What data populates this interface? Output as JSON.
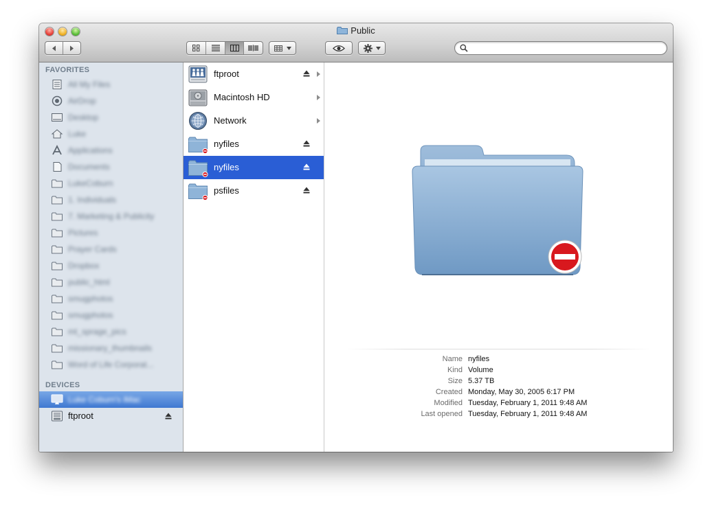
{
  "window": {
    "title": "Public",
    "title_icon": "folder-icon"
  },
  "toolbar": {
    "back_icon": "chevron-left-icon",
    "forward_icon": "chevron-right-icon",
    "view_modes": [
      "icon-view",
      "list-view",
      "column-view",
      "coverflow-view"
    ],
    "active_view": "column-view",
    "arrange_icon": "arrange-grid-icon",
    "quicklook_icon": "eye-icon",
    "action_icon": "gear-icon",
    "search_placeholder": "",
    "search_value": ""
  },
  "sidebar": {
    "favorites_heading": "FAVORITES",
    "favorites": [
      {
        "label": "All My Files",
        "icon": "all-files-icon"
      },
      {
        "label": "AirDrop",
        "icon": "airdrop-icon"
      },
      {
        "label": "Desktop",
        "icon": "desktop-icon"
      },
      {
        "label": "Luke",
        "icon": "home-icon"
      },
      {
        "label": "Applications",
        "icon": "applications-icon"
      },
      {
        "label": "Documents",
        "icon": "documents-icon"
      },
      {
        "label": "LukeCoburn",
        "icon": "folder-icon"
      },
      {
        "label": "1. Individuals",
        "icon": "folder-icon"
      },
      {
        "label": "7. Marketing & Publicity",
        "icon": "folder-icon"
      },
      {
        "label": "Pictures",
        "icon": "folder-icon"
      },
      {
        "label": "Prayer Cards",
        "icon": "folder-icon"
      },
      {
        "label": "Dropbox",
        "icon": "folder-icon"
      },
      {
        "label": "public_html",
        "icon": "folder-icon"
      },
      {
        "label": "smugphotos",
        "icon": "folder-icon"
      },
      {
        "label": "smugphotos",
        "icon": "folder-icon"
      },
      {
        "label": "mt_sprage_pics",
        "icon": "folder-icon"
      },
      {
        "label": "missionary_thumbnails",
        "icon": "folder-icon"
      },
      {
        "label": "Word of Life Corporat...",
        "icon": "folder-icon"
      }
    ],
    "devices_heading": "DEVICES",
    "devices": [
      {
        "label": "Luke Coburn's iMac",
        "icon": "imac-icon",
        "selected": true
      },
      {
        "label": "ftproot",
        "icon": "server-icon",
        "eject": true
      }
    ]
  },
  "column": {
    "items": [
      {
        "label": "ftproot",
        "icon": "network-share-icon",
        "eject": true,
        "arrow": true,
        "selected": false
      },
      {
        "label": "Macintosh HD",
        "icon": "hard-drive-icon",
        "eject": false,
        "arrow": true,
        "selected": false
      },
      {
        "label": "Network",
        "icon": "network-globe-icon",
        "eject": false,
        "arrow": true,
        "selected": false
      },
      {
        "label": "nyfiles",
        "icon": "restricted-folder-icon",
        "eject": true,
        "arrow": false,
        "selected": false
      },
      {
        "label": "nyfiles",
        "icon": "restricted-folder-icon",
        "eject": true,
        "arrow": false,
        "selected": true
      },
      {
        "label": "psfiles",
        "icon": "restricted-folder-icon",
        "eject": true,
        "arrow": false,
        "selected": false
      }
    ]
  },
  "preview": {
    "icon": "restricted-folder-large-icon",
    "info": [
      {
        "label": "Name",
        "value": "nyfiles"
      },
      {
        "label": "Kind",
        "value": "Volume"
      },
      {
        "label": "Size",
        "value": "5.37 TB"
      },
      {
        "label": "Created",
        "value": "Monday, May 30, 2005 6:17 PM"
      },
      {
        "label": "Modified",
        "value": "Tuesday, February 1, 2011 9:48 AM"
      },
      {
        "label": "Last opened",
        "value": "Tuesday, February 1, 2011 9:48 AM"
      }
    ]
  },
  "colors": {
    "selection_blue": "#2a5ed5",
    "sidebar_bg": "#dde4ec",
    "folder_blue": "#7fa8cf",
    "restricted_red": "#d8181e"
  }
}
